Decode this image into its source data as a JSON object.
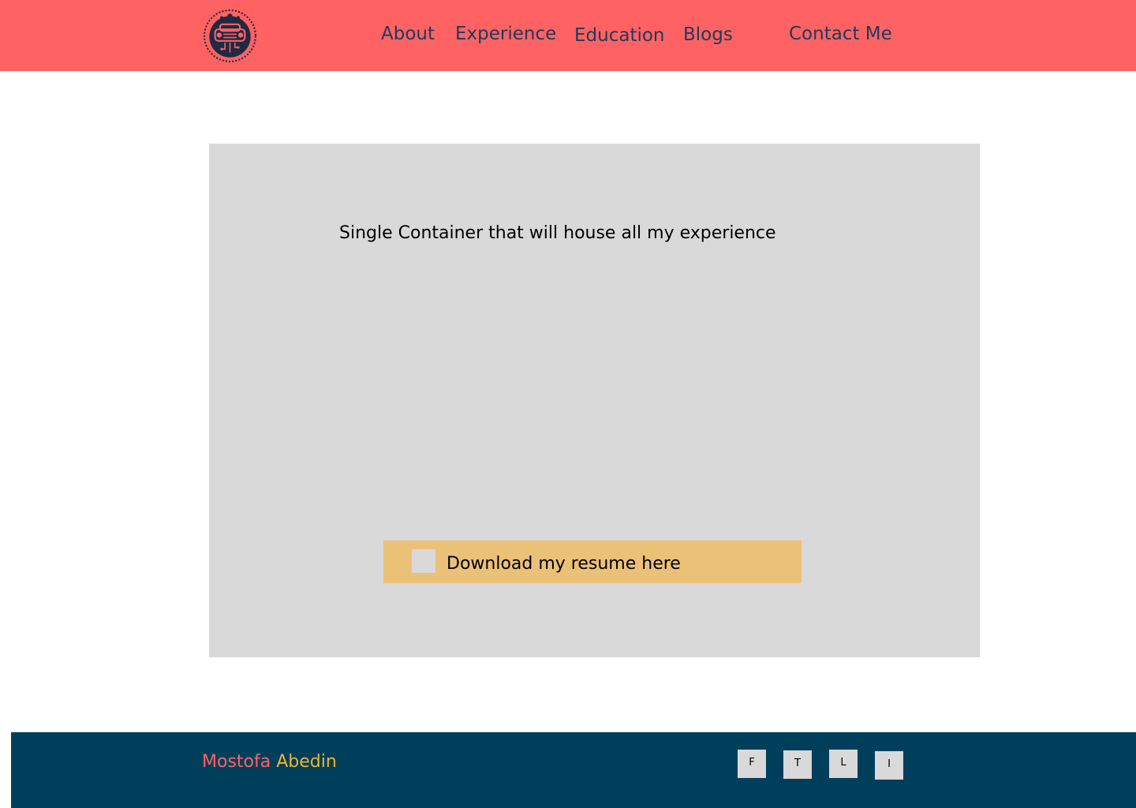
{
  "header": {
    "logo": "circuit-car-logo",
    "nav": {
      "about": "About",
      "experience": "Experience",
      "education": "Education",
      "blogs": "Blogs",
      "contact": "Contact Me"
    }
  },
  "main": {
    "container_text": "Single Container that will house all my experience",
    "resume_button_label": "Download my resume here"
  },
  "footer": {
    "first_name": "Mostofa",
    "last_name": "Abedin",
    "social": {
      "f": "F",
      "t": "T",
      "l": "L",
      "i": "I"
    }
  },
  "colors": {
    "header_bg": "#ff6262",
    "nav_text": "#1f3a5c",
    "container_bg": "#d9d9d9",
    "button_bg": "#ebc178",
    "footer_bg": "#003f5c",
    "first_name": "#ff6262",
    "last_name": "#ebb52f"
  }
}
